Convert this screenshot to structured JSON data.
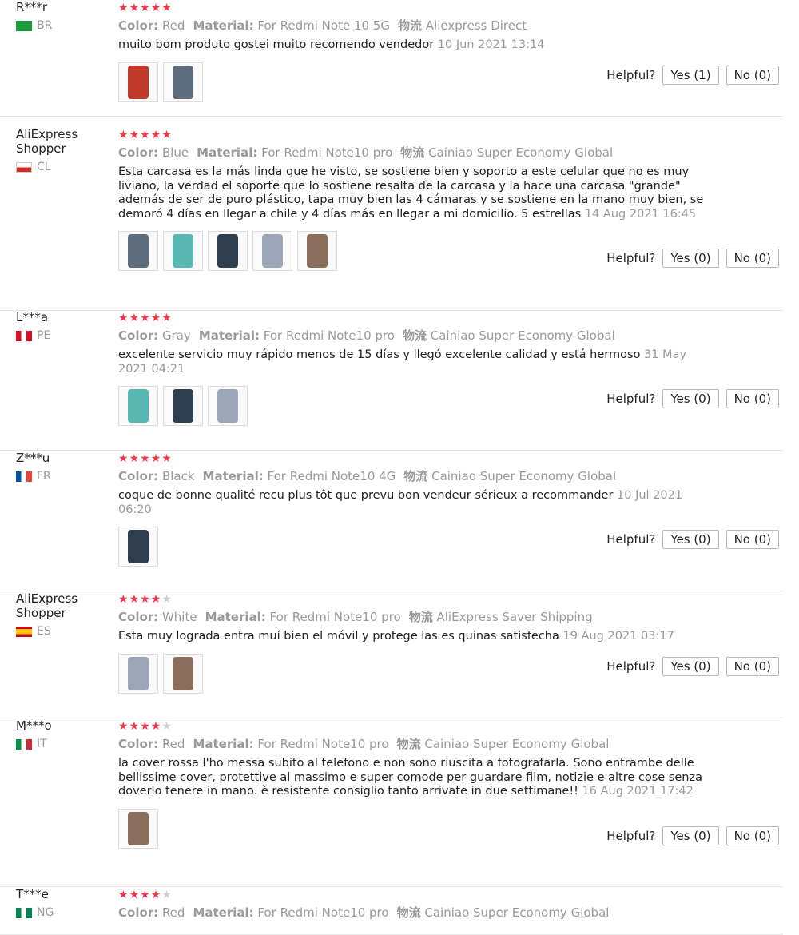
{
  "labels": {
    "color": "Color:",
    "material": "Material:",
    "shipping": "物流",
    "helpful": "Helpful?"
  },
  "colors": {
    "star": "#f43545",
    "star_empty": "#cfcfcf",
    "muted_text": "#999999"
  },
  "reviews": [
    {
      "user": "R***r",
      "country": "BR",
      "flag": "flag-br-icon",
      "stars": 5,
      "color": "Red",
      "material": "For Redmi Note 10 5G",
      "shipping": "Aliexpress Direct",
      "text": "muito bom produto gostei muito recomendo vendedor",
      "date": "10 Jun 2021 13:14",
      "photos": 2,
      "yes": "Yes (1)",
      "no": "No (0)"
    },
    {
      "user": "AliExpress\nShopper",
      "country": "CL",
      "flag": "flag-cl-icon",
      "stars": 5,
      "color": "Blue",
      "material": "For Redmi Note10 pro",
      "shipping": "Cainiao Super Economy Global",
      "text": "Esta carcasa es la más linda que he visto, se sostiene bien y soporto a este celular que no es muy liviano, la verdad el soporte que lo sostiene resalta de la carcasa y la hace una carcasa \"grande\" además de ser de puro plástico, tapa muy bien las 4 cámaras y se sostiene en la mano muy bien, se demoró 4 días en llegar a chile y 4 días más en llegar a mi domicilio. 5 estrellas",
      "date": "14 Aug 2021 16:45",
      "photos": 5,
      "yes": "Yes (0)",
      "no": "No (0)"
    },
    {
      "user": "L***a",
      "country": "PE",
      "flag": "flag-pe-icon",
      "stars": 5,
      "color": "Gray",
      "material": "For Redmi Note10 pro",
      "shipping": "Cainiao Super Economy Global",
      "text": "excelente servicio muy rápido menos de 15 días y llegó excelente calidad y está hermoso",
      "date": "31 May 2021 04:21",
      "photos": 3,
      "yes": "Yes (0)",
      "no": "No (0)"
    },
    {
      "user": "Z***u",
      "country": "FR",
      "flag": "flag-fr-icon",
      "stars": 5,
      "color": "Black",
      "material": "For Redmi Note10 4G",
      "shipping": "Cainiao Super Economy Global",
      "text": "coque de bonne qualité recu plus tôt que prevu bon vendeur sérieux a recommander",
      "date": "10 Jul 2021 06:20",
      "photos": 1,
      "yes": "Yes (0)",
      "no": "No (0)"
    },
    {
      "user": "AliExpress\nShopper",
      "country": "ES",
      "flag": "flag-es-icon",
      "stars": 4,
      "color": "White",
      "material": "For Redmi Note10 pro",
      "shipping": "AliExpress Saver Shipping",
      "text": "Esta muy lograda entra muí bien el móvil y protege las es quinas satisfecha",
      "date": "19 Aug 2021 03:17",
      "photos": 2,
      "yes": "Yes (0)",
      "no": "No (0)"
    },
    {
      "user": "M***o",
      "country": "IT",
      "flag": "flag-it-icon",
      "stars": 4,
      "color": "Red",
      "material": "For Redmi Note10 pro",
      "shipping": "Cainiao Super Economy Global",
      "text": "la cover rossa l'ho messa subito al telefono e non sono riuscita a fotografarla. Sono entrambe delle bellissime cover, protettive al massimo e super comode per guardare film, notizie e altre cose senza doverlo tenere in mano. è resistente consiglio tanto arrivate in due settimane!!",
      "date": "16 Aug 2021 17:42",
      "photos": 1,
      "yes": "Yes (0)",
      "no": "No (0)"
    },
    {
      "user": "T***e",
      "country": "NG",
      "flag": "flag-ng-icon",
      "stars": 4,
      "color": "Red",
      "material": "For Redmi Note10 pro",
      "shipping": "Cainiao Super Economy Global",
      "text": "",
      "date": "",
      "photos": 0,
      "yes": "",
      "no": ""
    }
  ]
}
